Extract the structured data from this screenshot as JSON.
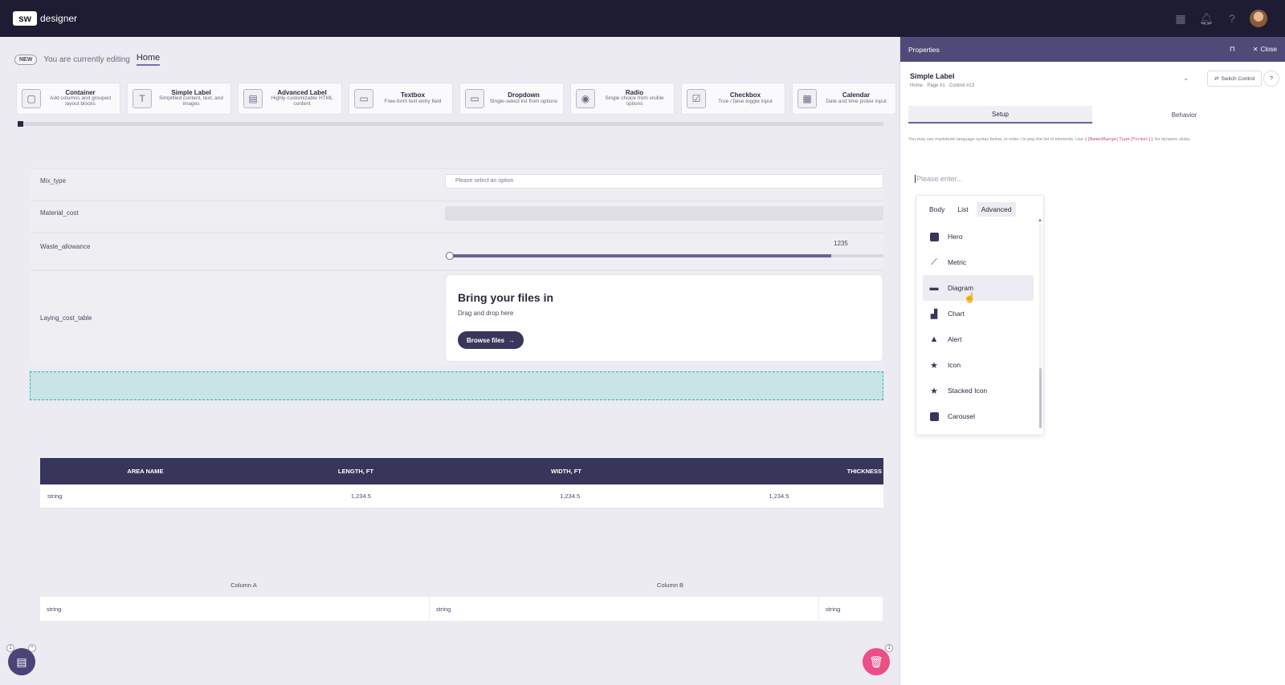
{
  "app": {
    "logo_mark": "sw",
    "logo_text": "designer"
  },
  "topbar": {
    "icons": [
      "grid-icon",
      "bell-icon",
      "help-icon"
    ]
  },
  "edit_bar": {
    "badge": "NEW",
    "text": "You are currently editing",
    "page": "Home"
  },
  "palette": [
    {
      "icon": "container-icon",
      "glyph": "▢",
      "title": "Container",
      "desc": "Add columns and grouped layout blocks"
    },
    {
      "icon": "simple-label-icon",
      "glyph": "T",
      "title": "Simple Label",
      "desc": "Simplified content, text, and images"
    },
    {
      "icon": "advanced-label-icon",
      "glyph": "▤",
      "title": "Advanced Label",
      "desc": "Highly customizable HTML content"
    },
    {
      "icon": "textbox-icon",
      "glyph": "▭",
      "title": "Textbox",
      "desc": "Free-form text entry field"
    },
    {
      "icon": "dropdown-icon",
      "glyph": "▭",
      "title": "Dropdown",
      "desc": "Single-select list from options"
    },
    {
      "icon": "radio-icon",
      "glyph": "◉",
      "title": "Radio",
      "desc": "Single choice from visible options"
    },
    {
      "icon": "checkbox-icon",
      "glyph": "☑",
      "title": "Checkbox",
      "desc": "True / false toggle input"
    },
    {
      "icon": "calendar-icon",
      "glyph": "▦",
      "title": "Calendar",
      "desc": "Date and time picker input"
    }
  ],
  "form": {
    "mix_type_label": "Mix_type",
    "mix_type_placeholder": "Please select an option",
    "material_cost_label": "Material_cost",
    "waste_label": "Waste_allowance",
    "waste_value": "1235",
    "waste_fraction": 0.88,
    "laying_label": "Laying_cost_table",
    "upload_title": "Bring your files in",
    "upload_sub": "Drag and drop here",
    "browse_label": "Browse files"
  },
  "table1": {
    "headers": [
      "AREA NAME",
      "LENGTH, FT",
      "WIDTH, FT",
      "THICKNESS"
    ],
    "row": [
      "string",
      "1,234.5",
      "1,234.5",
      "1,234.5"
    ]
  },
  "table2": {
    "headers": [
      "Column A",
      "Column B"
    ],
    "row": [
      "string",
      "string",
      "string"
    ]
  },
  "fab": {
    "left_badge": "1",
    "right_badge": "1"
  },
  "panel": {
    "title": "Properties",
    "close_label": "Close",
    "control_name": "Simple Label",
    "control_path": "Home · Page #1 · Control #13",
    "switch_label": "Switch Control",
    "help_label": "?",
    "tabs": [
      "Setup",
      "Behavior"
    ],
    "hint_pre": "You may use markdown language syntax below, or enter",
    "hint_slash": "/",
    "hint_mid": "to pop the list of elements. Use",
    "hint_code": "{{NamedRange|Type|Format}}",
    "hint_post": "for dynamic stubs.",
    "editor_placeholder": "Please enter..."
  },
  "menu": {
    "tabs": [
      "Body",
      "List",
      "Advanced"
    ],
    "active_tab": "Advanced",
    "items": [
      {
        "label": "Hero",
        "icon": "hero-icon"
      },
      {
        "label": "Metric",
        "icon": "metric-icon"
      },
      {
        "label": "Diagram",
        "icon": "diagram-icon"
      },
      {
        "label": "Chart",
        "icon": "chart-icon"
      },
      {
        "label": "Alert",
        "icon": "alert-icon"
      },
      {
        "label": "Icon",
        "icon": "star-icon"
      },
      {
        "label": "Stacked Icon",
        "icon": "stacked-star-icon"
      },
      {
        "label": "Carousel",
        "icon": "carousel-icon"
      }
    ],
    "hovered": "Diagram"
  }
}
